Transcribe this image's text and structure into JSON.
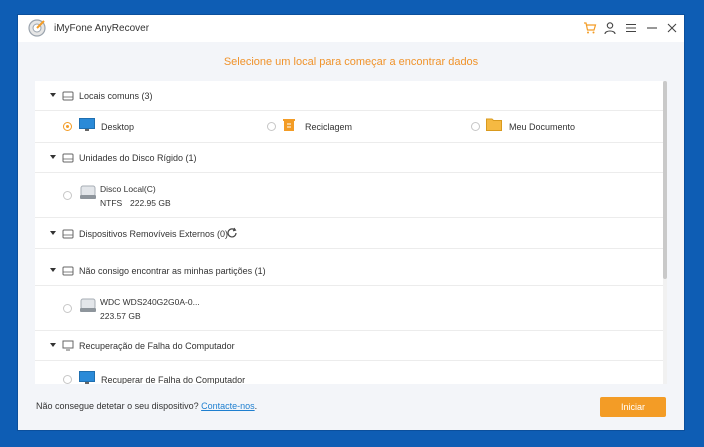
{
  "window": {
    "title": "iMyFone AnyRecover"
  },
  "header": {
    "title": "Selecione um local para começar a encontrar dados"
  },
  "groups": {
    "common": {
      "label": "Locais comuns (3)",
      "items": [
        {
          "label": "Desktop",
          "icon": "desktop-icon",
          "selected": true
        },
        {
          "label": "Reciclagem",
          "icon": "recycle-bin-icon",
          "selected": false
        },
        {
          "label": "Meu Documento",
          "icon": "folder-icon",
          "selected": false
        }
      ]
    },
    "hard_disks": {
      "label": "Unidades do Disco Rígido (1)",
      "drive": {
        "name": "Disco Local(C)",
        "fs": "NTFS",
        "size": "222.95 GB"
      }
    },
    "external": {
      "label": "Dispositivos Removíveis Externos (0)"
    },
    "partitions": {
      "label": "Não consigo encontrar as minhas partições (1)",
      "drive": {
        "name": "WDC WDS240G2G0A-0...",
        "size": "223.57 GB"
      }
    },
    "crash": {
      "label": "Recuperação de Falha do Computador",
      "item": "Recuperar de Falha do Computador"
    }
  },
  "footer": {
    "text": "Não consegue detetar o seu dispositivo? ",
    "link": "Contacte-nos",
    "link_suffix": "."
  },
  "buttons": {
    "start": "Iniciar"
  },
  "colors": {
    "accent": "#f39c26",
    "background": "#0e5db4",
    "link": "#1e7fd0"
  }
}
